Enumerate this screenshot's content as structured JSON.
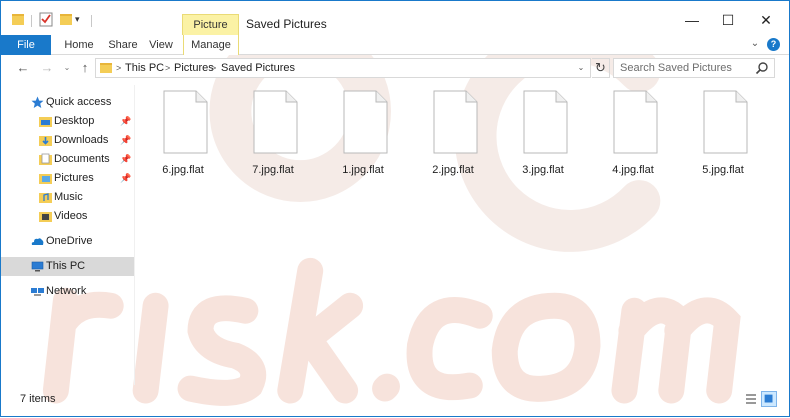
{
  "window": {
    "title": "Saved Pictures",
    "context_tab_group": "Picture Tools",
    "controls": {
      "minimize": "—",
      "maximize": "☐",
      "close": "✕"
    }
  },
  "quick_access_toolbar": {
    "dropdown": "▾"
  },
  "ribbon": {
    "tabs": [
      {
        "label": "File"
      },
      {
        "label": "Home"
      },
      {
        "label": "Share"
      },
      {
        "label": "View"
      },
      {
        "label": "Manage"
      }
    ],
    "expand_glyph": "⌄",
    "help_glyph": "?"
  },
  "navigation": {
    "back": "←",
    "forward": "→",
    "recent": "⌄",
    "up": "↑",
    "breadcrumb": [
      "This PC",
      "Pictures",
      "Saved Pictures"
    ],
    "crumb_separator": ">",
    "address_dropdown": "⌄",
    "refresh": "↻"
  },
  "search": {
    "placeholder": "Search Saved Pictures"
  },
  "sidebar": {
    "items": [
      {
        "label": "Quick access",
        "icon": "star-icon",
        "pinned": false
      },
      {
        "label": "Desktop",
        "icon": "desktop-folder-icon",
        "pinned": true
      },
      {
        "label": "Downloads",
        "icon": "downloads-folder-icon",
        "pinned": true
      },
      {
        "label": "Documents",
        "icon": "documents-folder-icon",
        "pinned": true
      },
      {
        "label": "Pictures",
        "icon": "pictures-folder-icon",
        "pinned": true
      },
      {
        "label": "Music",
        "icon": "music-folder-icon",
        "pinned": false
      },
      {
        "label": "Videos",
        "icon": "videos-folder-icon",
        "pinned": false
      },
      {
        "label": "OneDrive",
        "icon": "onedrive-icon",
        "pinned": false
      },
      {
        "label": "This PC",
        "icon": "computer-icon",
        "pinned": false,
        "selected": true
      },
      {
        "label": "Network",
        "icon": "network-icon",
        "pinned": false
      }
    ],
    "pin_glyph": "📌"
  },
  "files": [
    {
      "name": "6.jpg.flat"
    },
    {
      "name": "7.jpg.flat"
    },
    {
      "name": "1.jpg.flat"
    },
    {
      "name": "2.jpg.flat"
    },
    {
      "name": "3.jpg.flat"
    },
    {
      "name": "4.jpg.flat"
    },
    {
      "name": "5.jpg.flat"
    }
  ],
  "status": {
    "item_count": "7 items"
  },
  "colors": {
    "accent": "#1979ca",
    "context_tab": "#fbf2a5",
    "selection": "#d9d9d9",
    "watermark": "#f3e4df"
  }
}
